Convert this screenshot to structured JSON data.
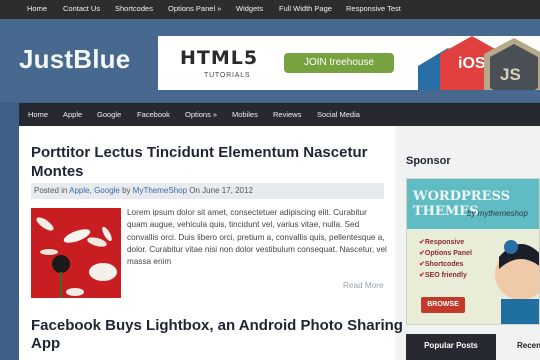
{
  "top_menu": [
    "Home",
    "Contact Us",
    "Shortcodes",
    "Options Panel »",
    "Widgets",
    "Full Width Page",
    "Responsive Test"
  ],
  "site": {
    "logo": "JustBlue"
  },
  "banner": {
    "headline": "HTML5",
    "subline": "TUTORIALS",
    "cta": "JOIN treehouse",
    "badges": [
      "iOS",
      "JS"
    ]
  },
  "main_menu": [
    "Home",
    "Apple",
    "Google",
    "Facebook",
    "Options »",
    "Mobiles",
    "Reviews",
    "Social Media"
  ],
  "post1": {
    "title_line1": "Porttitor Lectus Tincidunt Elementum Nascetur",
    "title_line2": "Montes",
    "meta_posted_in": "Posted in",
    "meta_cat1": "Apple",
    "meta_sep": ",",
    "meta_cat2": "Google",
    "meta_by": "by",
    "meta_author": "MyThemeShop",
    "meta_on": "On June 17, 2012",
    "excerpt": "Lorem ipsum dolor sit amet, consectetuer adipiscing elit. Curabitur quam augue, vehicula quis, tincidunt vel, varius vitae, nulla. Sed convallis orci. Duis libero orci, pretium a, convallis quis, pellentesque a, dolor. Curabitur vitae nisi non dolor vestibulum consequat. Nascetur, vel massa enim",
    "read_more": "Read More"
  },
  "post2": {
    "title_line1": "Facebook Buys Lightbox, an Android Photo Sharing",
    "title_line2": "App"
  },
  "sidebar": {
    "sponsor_title": "Sponsor",
    "ad": {
      "headline": "WORDPRESS THEMES",
      "byline": "by mythemeshop",
      "features": [
        "Responsive",
        "Options Panel",
        "Shortcodes",
        "SEO friendly"
      ],
      "button": "BROWSE"
    },
    "tabs": [
      "Popular Posts",
      "Recent"
    ]
  },
  "colors": {
    "header_blue": "#476990",
    "topbar": "#2d2d2d",
    "navbar": "#262a30",
    "link": "#3b6aa5",
    "treehouse_green": "#78a23f"
  }
}
